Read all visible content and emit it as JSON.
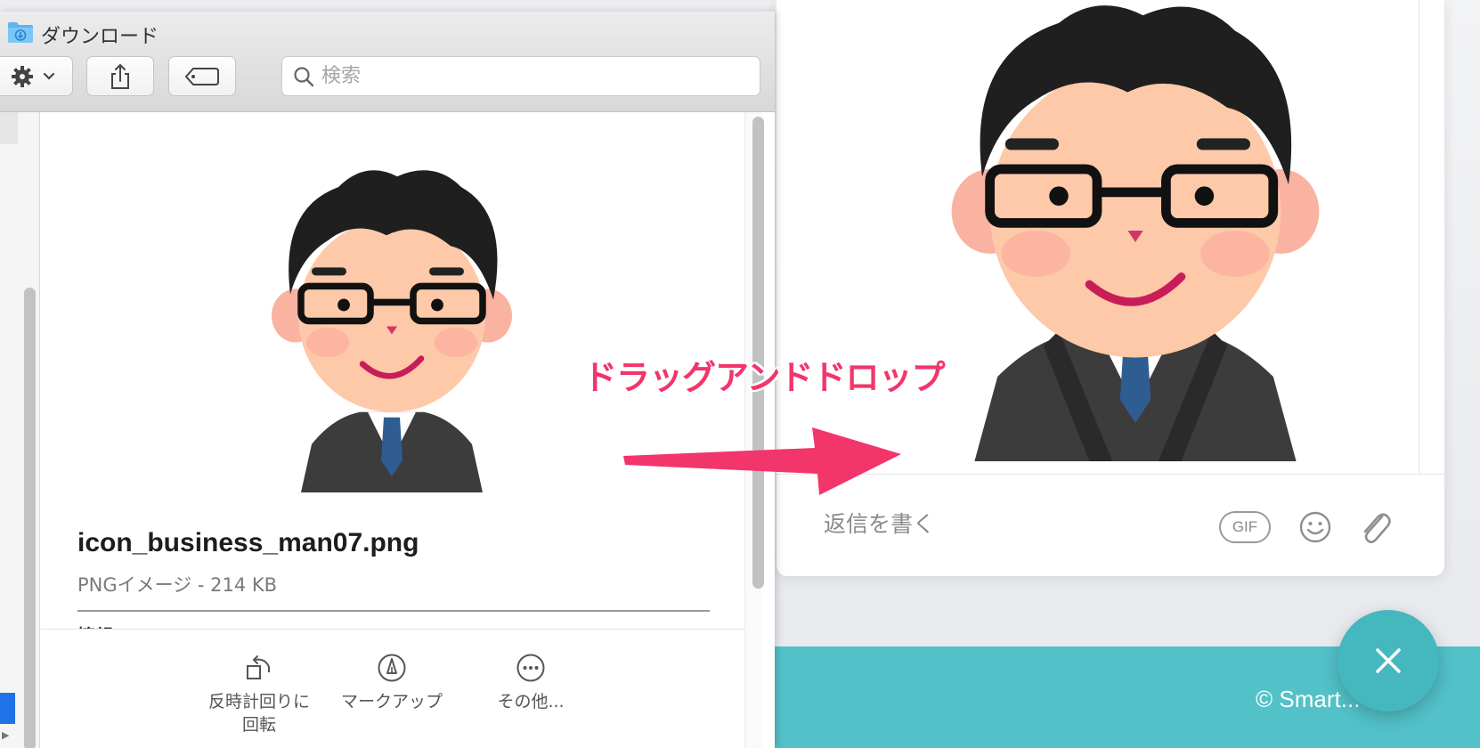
{
  "finder": {
    "title": "ダウンロード",
    "search_placeholder": "検索",
    "file_name": "icon_business_man07.png",
    "file_kind": "PNGイメージ - 214 KB",
    "info_heading": "情報",
    "quick_actions": [
      {
        "label": "反時計回りに\n回転",
        "icon": "rotate-left-icon"
      },
      {
        "label": "マークアップ",
        "icon": "markup-pen-icon"
      },
      {
        "label": "その他...",
        "icon": "more-ellipsis-icon"
      }
    ]
  },
  "chat": {
    "reply_placeholder": "返信を書く",
    "gif_label": "GIF",
    "icons": [
      "gif-icon",
      "emoji-icon",
      "paperclip-icon"
    ]
  },
  "footer": {
    "copyright": "© Smart... Inc."
  },
  "annotation": {
    "text": "ドラッグアンドドロップ",
    "color": "#f2356b"
  },
  "colors": {
    "teal": "#52c1c8",
    "fab": "#45b8bf",
    "selection_blue": "#1f73e6"
  }
}
